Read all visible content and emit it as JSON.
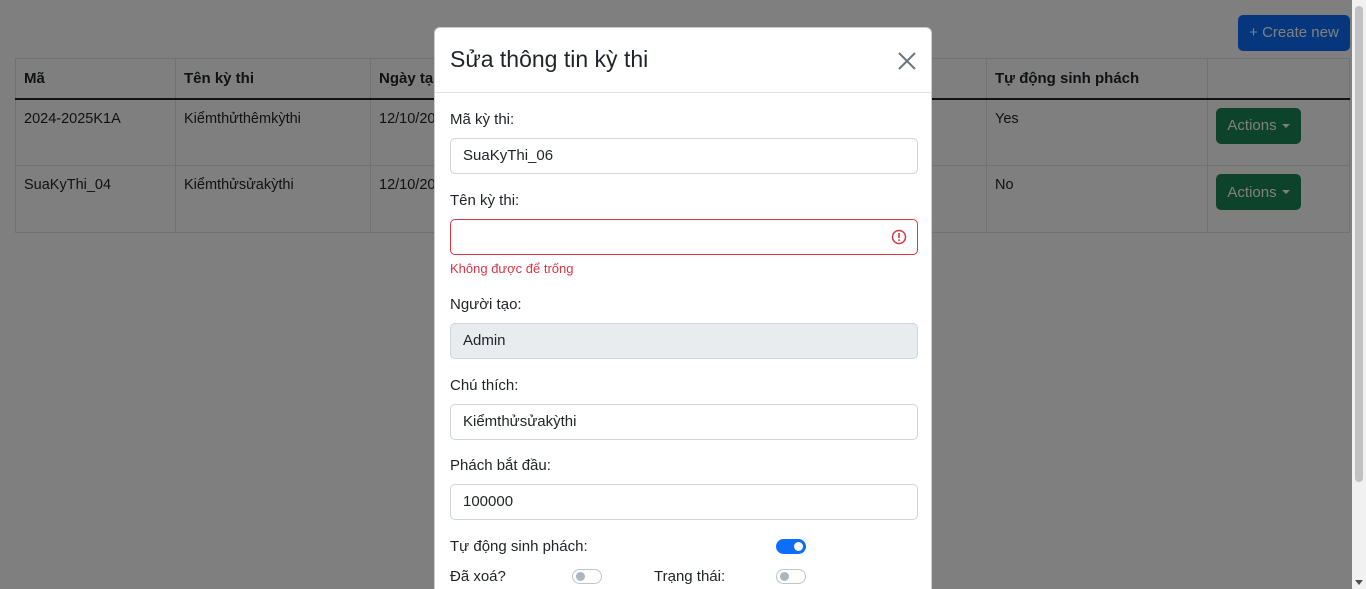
{
  "page": {
    "create_button": "+ Create new",
    "table": {
      "headers": [
        "Mã",
        "Tên kỳ thi",
        "Ngày tạ",
        "",
        "Tự động sinh phách",
        ""
      ],
      "rows": [
        {
          "ma": "2024-2025K1A",
          "ten": "Kiểmthửthêmkỳthi",
          "ngay": "12/10/20",
          "auto": "Yes",
          "actions": "Actions"
        },
        {
          "ma": "SuaKyThi_04",
          "ten": "Kiểmthửsửakỳthi",
          "ngay": "12/10/20",
          "auto": "No",
          "actions": "Actions"
        }
      ]
    }
  },
  "modal": {
    "title": "Sửa thông tin kỳ thi",
    "fields": {
      "ma_label": "Mã kỳ thi:",
      "ma_value": "SuaKyThi_06",
      "ten_label": "Tên kỳ thi:",
      "ten_value": "",
      "ten_error": "Không được để trống",
      "nguoi_tao_label": "Người tạo:",
      "nguoi_tao_value": "Admin",
      "chu_thich_label": "Chú thích:",
      "chu_thich_value": "Kiểmthửsửakỳthi",
      "phach_label": "Phách bắt đầu:",
      "phach_value": "100000",
      "auto_label": "Tự động sinh phách:",
      "auto_on": true,
      "da_xoa_label": "Đã xoá?",
      "da_xoa_on": false,
      "trang_thai_label": "Trạng thái:",
      "trang_thai_on": false
    }
  },
  "colors": {
    "primary": "#0d6efd",
    "success": "#198754",
    "danger": "#dc3545"
  }
}
